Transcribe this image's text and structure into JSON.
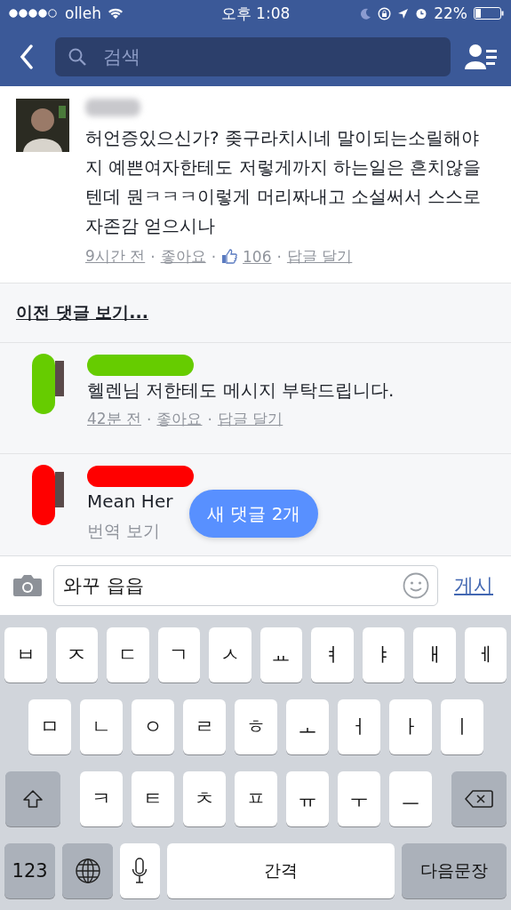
{
  "status_bar": {
    "carrier": "olleh",
    "time": "오후 1:08",
    "battery": "22%"
  },
  "nav": {
    "search": {
      "placeholder": "검색"
    }
  },
  "comment": {
    "text": "허언증있으신가? 좆구라치시네 말이되는소릴해야지 예쁜여자한테도 저렇게까지 하는일은 흔치않을텐데 뭔ㅋㅋㅋ이렇게 머리짜내고 소설써서 스스로 자존감 얻으시나",
    "time": "9시간 전",
    "like": "좋아요",
    "like_count": "106",
    "reply": "답글 달기",
    "separator": "·"
  },
  "previous_link": "이전 댓글 보기...",
  "replies": [
    {
      "kind": "text",
      "text": "헬렌님 저한테도 메시지 부탁드립니다.",
      "time": "42분 전",
      "like": "좋아요",
      "reply": "답글 달기",
      "separator": "·",
      "color": "#66cc00"
    },
    {
      "kind": "translate",
      "text": "Mean Her",
      "translate": "번역 보기",
      "color": "#ff0000"
    }
  ],
  "new_comments_pill": "새 댓글 2개",
  "composer": {
    "value": "와꾸 읍읍",
    "post": "게시"
  },
  "keyboard": {
    "letter_rows": [
      {
        "keys": [
          "ㅂ",
          "ㅈ",
          "ㄷ",
          "ㄱ",
          "ㅅ",
          "ㅛ",
          "ㅕ",
          "ㅑ",
          "ㅐ",
          "ㅔ"
        ]
      },
      {
        "keys": [
          "ㅁ",
          "ㄴ",
          "ㅇ",
          "ㄹ",
          "ㅎ",
          "ㅗ",
          "ㅓ",
          "ㅏ",
          "ㅣ"
        ]
      },
      {
        "keys": [
          "ㅋ",
          "ㅌ",
          "ㅊ",
          "ㅍ",
          "ㅠ",
          "ㅜ",
          "ㅡ"
        ],
        "shift_key": true,
        "backspace_key": true
      }
    ],
    "numbers_key": "123",
    "space_key": "간격",
    "return_key": "다음문장"
  }
}
